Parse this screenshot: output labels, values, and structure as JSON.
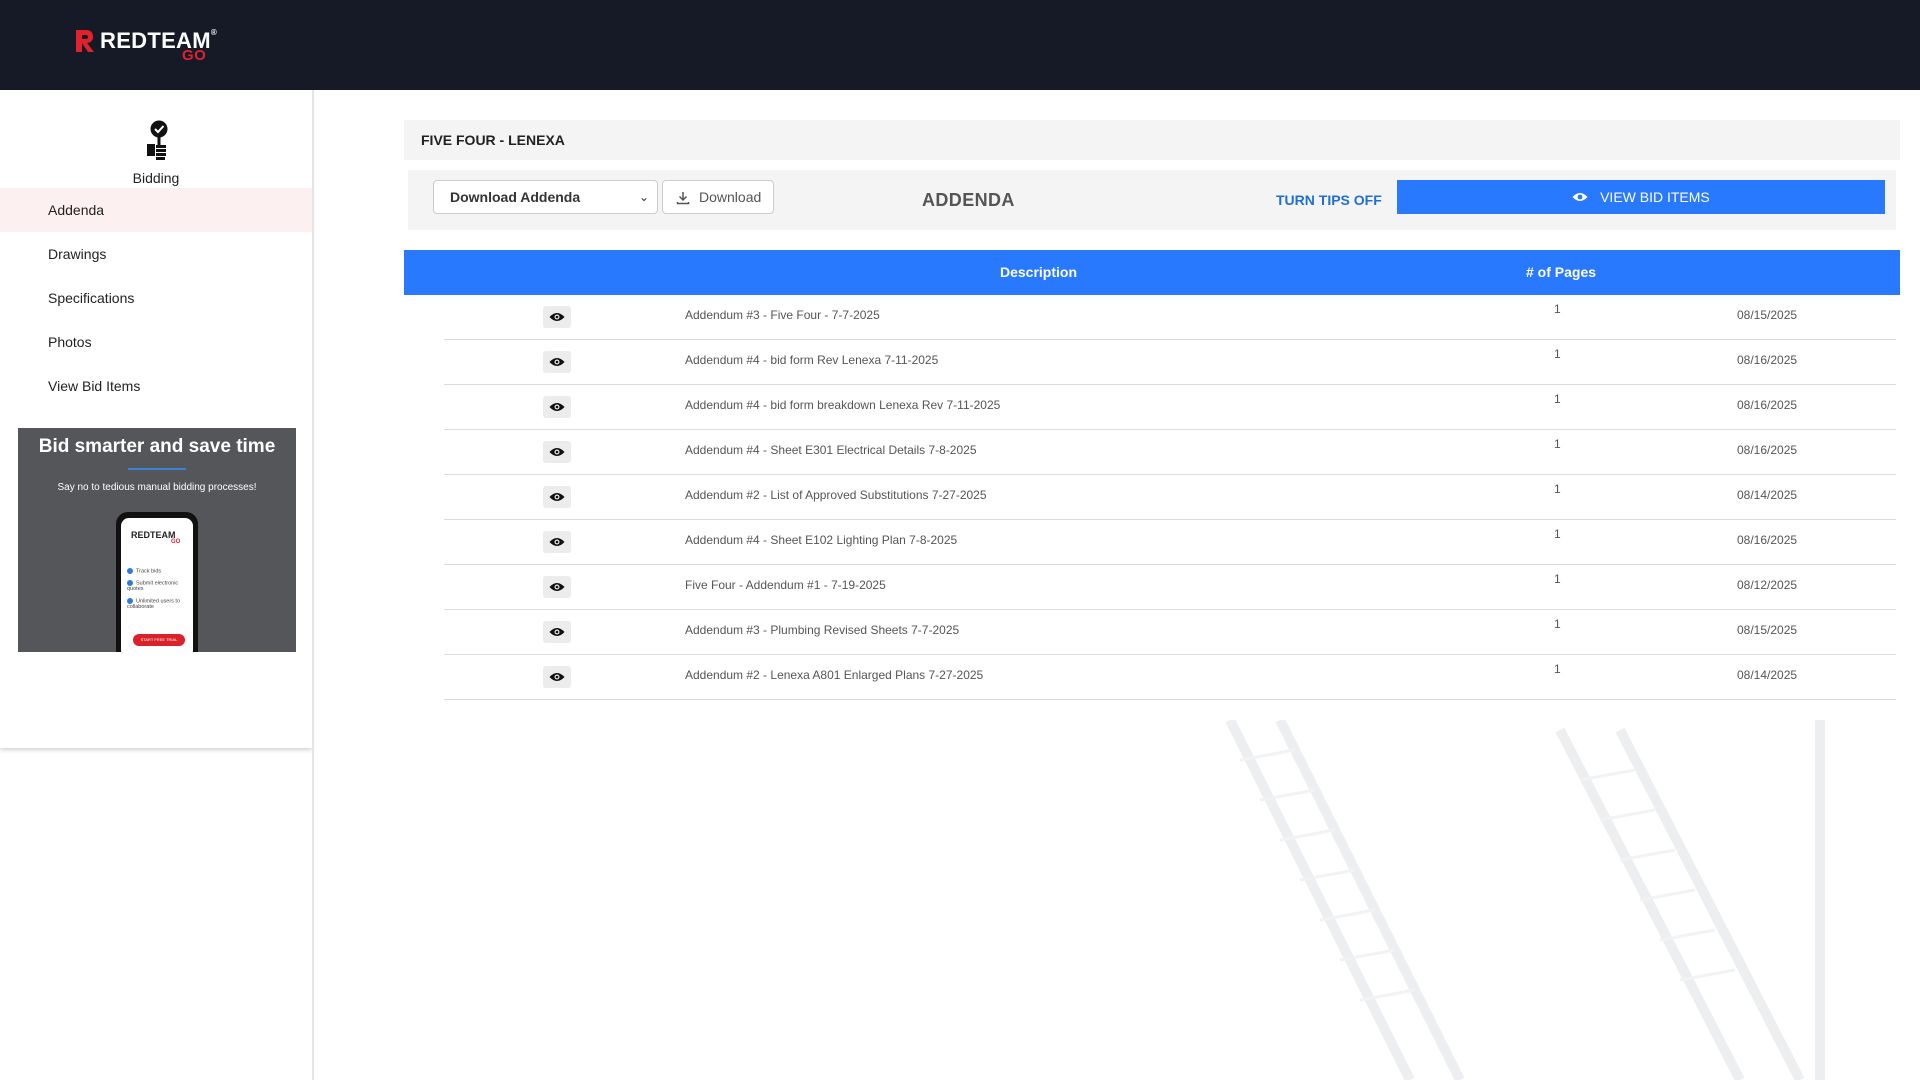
{
  "brand": {
    "name": "REDTEAM",
    "reg": "®",
    "sub": "GO"
  },
  "sidebar": {
    "section_label": "Bidding",
    "items": [
      {
        "label": "Addenda",
        "active": true
      },
      {
        "label": "Drawings"
      },
      {
        "label": "Specifications"
      },
      {
        "label": "Photos"
      },
      {
        "label": "View Bid Items"
      }
    ],
    "promo": {
      "title": "Bid smarter and save time",
      "subtitle": "Say no to tedious manual bidding processes!",
      "phone_features": [
        "Track bids",
        "Submit electronic quotes",
        "Unlimited users to collaborate"
      ],
      "phone_button": "START FREE TRIAL"
    }
  },
  "project": {
    "title": "FIVE FOUR - LENEXA"
  },
  "toolbar": {
    "select_value": "Download Addenda",
    "download_label": "Download",
    "section_title": "ADDENDA",
    "tips_label": "TURN TIPS OFF",
    "view_bid_label": "VIEW BID ITEMS"
  },
  "table": {
    "headers": {
      "description": "Description",
      "pages": "# of Pages"
    },
    "rows": [
      {
        "description": "Addendum #3 - Five Four - 7-7-2025",
        "pages": "1",
        "date": "08/15/2025"
      },
      {
        "description": "Addendum #4 - bid form Rev Lenexa 7-11-2025",
        "pages": "1",
        "date": "08/16/2025"
      },
      {
        "description": "Addendum #4 - bid form breakdown Lenexa Rev 7-11-2025",
        "pages": "1",
        "date": "08/16/2025"
      },
      {
        "description": "Addendum #4 - Sheet E301 Electrical Details 7-8-2025",
        "pages": "1",
        "date": "08/16/2025"
      },
      {
        "description": "Addendum #2 - List of Approved Substitutions 7-27-2025",
        "pages": "1",
        "date": "08/14/2025"
      },
      {
        "description": "Addendum #4 - Sheet E102 Lighting Plan 7-8-2025",
        "pages": "1",
        "date": "08/16/2025"
      },
      {
        "description": "Five Four - Addendum #1 - 7-19-2025",
        "pages": "1",
        "date": "08/12/2025"
      },
      {
        "description": "Addendum #3 - Plumbing Revised Sheets 7-7-2025",
        "pages": "1",
        "date": "08/15/2025"
      },
      {
        "description": "Addendum #2 - Lenexa A801 Enlarged Plans 7-27-2025",
        "pages": "1",
        "date": "08/14/2025"
      }
    ]
  },
  "colors": {
    "header_bg": "#161a27",
    "brand_red": "#e0222f",
    "accent_blue": "#2979ff",
    "link_blue": "#1f6fd8",
    "active_item_bg": "#fdf0f1"
  },
  "icons": {
    "logo_mark": "redteam-r-icon",
    "bidding": "gavel-check-icon",
    "download": "download-icon",
    "view": "eye-icon",
    "select": "chevron-down-icon"
  }
}
